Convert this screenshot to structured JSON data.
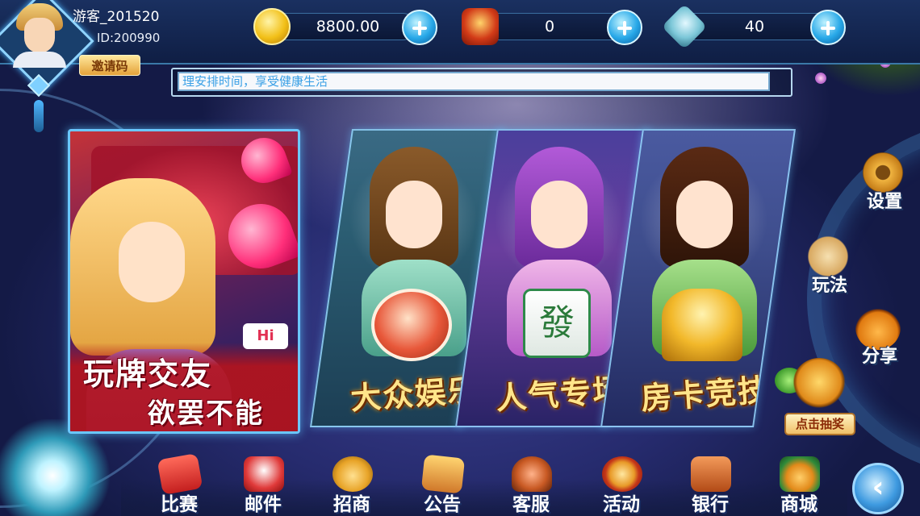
{
  "player": {
    "name": "游客_201520",
    "id": "ID:200990",
    "invite_label": "邀请码"
  },
  "resources": [
    {
      "icon": "gold-coin-icon",
      "value": "8800.00"
    },
    {
      "icon": "red-envelope-icon",
      "value": "0"
    },
    {
      "icon": "room-card-icon",
      "value": "40"
    }
  ],
  "marquee": {
    "text": "理安排时间，享受健康生活"
  },
  "promo": {
    "line1": "玩牌交友",
    "line2": "欲罢不能",
    "badge": "Hi"
  },
  "games": [
    {
      "title": "大众娱乐",
      "prop": "poker-chips"
    },
    {
      "title": "人气专场",
      "prop": "mahjong-tile",
      "tile_glyph": "發"
    },
    {
      "title": "房卡竞技",
      "prop": "trophy"
    }
  ],
  "side_menu": {
    "settings": "设置",
    "rules": "玩法",
    "share": "分享",
    "lottery": "点击抽奖"
  },
  "bottom_nav": [
    {
      "label": "比赛",
      "icon": "match-scroll-icon"
    },
    {
      "label": "邮件",
      "icon": "mail-icon"
    },
    {
      "label": "招商",
      "icon": "business-bag-icon"
    },
    {
      "label": "公告",
      "icon": "notice-icon"
    },
    {
      "label": "客服",
      "icon": "service-icon"
    },
    {
      "label": "活动",
      "icon": "event-icon"
    },
    {
      "label": "银行",
      "icon": "bank-icon"
    },
    {
      "label": "商城",
      "icon": "shop-icon"
    }
  ],
  "back_glyph": "‹",
  "colors": {
    "accent": "#3aa0e6",
    "title_gold": "#ffe58a",
    "frame_blue": "#6bc7ff"
  }
}
